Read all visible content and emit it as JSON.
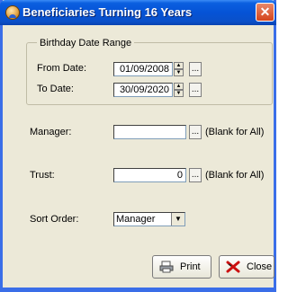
{
  "window": {
    "title": "Beneficiaries Turning 16 Years"
  },
  "birthday_range": {
    "group_label": "Birthday Date Range",
    "from_label": "From Date:",
    "from_value": "01/09/2008",
    "to_label": "To Date:",
    "to_value": "30/09/2020"
  },
  "manager": {
    "label": "Manager:",
    "value": "",
    "hint": "(Blank for All)"
  },
  "trust": {
    "label": "Trust:",
    "value": "0",
    "hint": "(Blank for All)"
  },
  "sort_order": {
    "label": "Sort Order:",
    "selected": "Manager"
  },
  "buttons": {
    "print_label": "Print",
    "close_label": "Close"
  },
  "glyphs": {
    "ellipsis": "...",
    "close_x": "✕",
    "up": "▲",
    "down": "▼"
  },
  "icons": {
    "app": "person-icon",
    "print": "printer-icon",
    "close": "x-icon"
  }
}
